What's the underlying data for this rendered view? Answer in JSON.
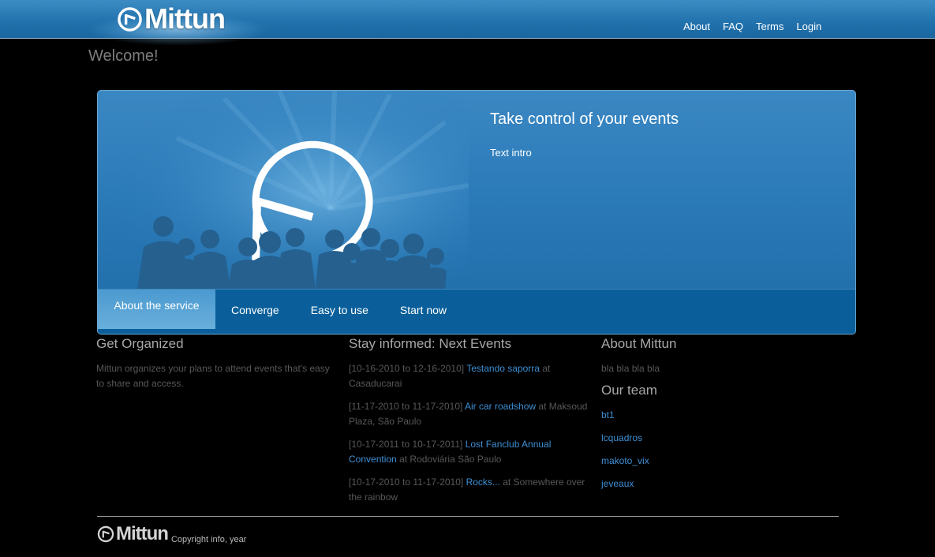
{
  "brand": {
    "name": "Mittun"
  },
  "nav": {
    "items": [
      "About",
      "FAQ",
      "Terms",
      "Login"
    ]
  },
  "welcome": "Welcome!",
  "hero": {
    "title": "Take control of your events",
    "text": "Text intro",
    "tabs": [
      "About the service",
      "Converge",
      "Easy to use",
      "Start now"
    ],
    "active_tab": 0
  },
  "organized": {
    "heading": "Get Organized",
    "text": "Mittun organizes your plans to attend events that's easy to share and access."
  },
  "events": {
    "heading": "Stay informed: Next Events",
    "items": [
      {
        "dates": "[10-16-2010 to 12-16-2010]",
        "name": "Testando saporra",
        "at": "at Casaducarai"
      },
      {
        "dates": "[11-17-2010 to 11-17-2010]",
        "name": "Air car roadshow",
        "at": "at Maksoud Plaza, São Paulo"
      },
      {
        "dates": "[10-17-2011 to 10-17-2011]",
        "name": "Lost Fanclub Annual Convention",
        "at": "at Rodoviária São Paulo"
      },
      {
        "dates": "[10-17-2010 to 11-17-2010]",
        "name": "Rocks...",
        "at": "at Somewhere over the rainbow"
      }
    ]
  },
  "about": {
    "heading": "About Mittun",
    "text": "bla bla bla bla",
    "team_heading": "Our team",
    "team": [
      "bt1",
      "lcquadros",
      "makoto_vix",
      "jeveaux"
    ]
  },
  "footer": {
    "brand": "Mittun",
    "copyright": "Copyright info, year"
  },
  "colors": {
    "header": "#2273ae",
    "link": "#3d8fd4",
    "tab_bar": "#0a5f9a"
  },
  "icons": {
    "logo": "clock-logo-icon"
  }
}
